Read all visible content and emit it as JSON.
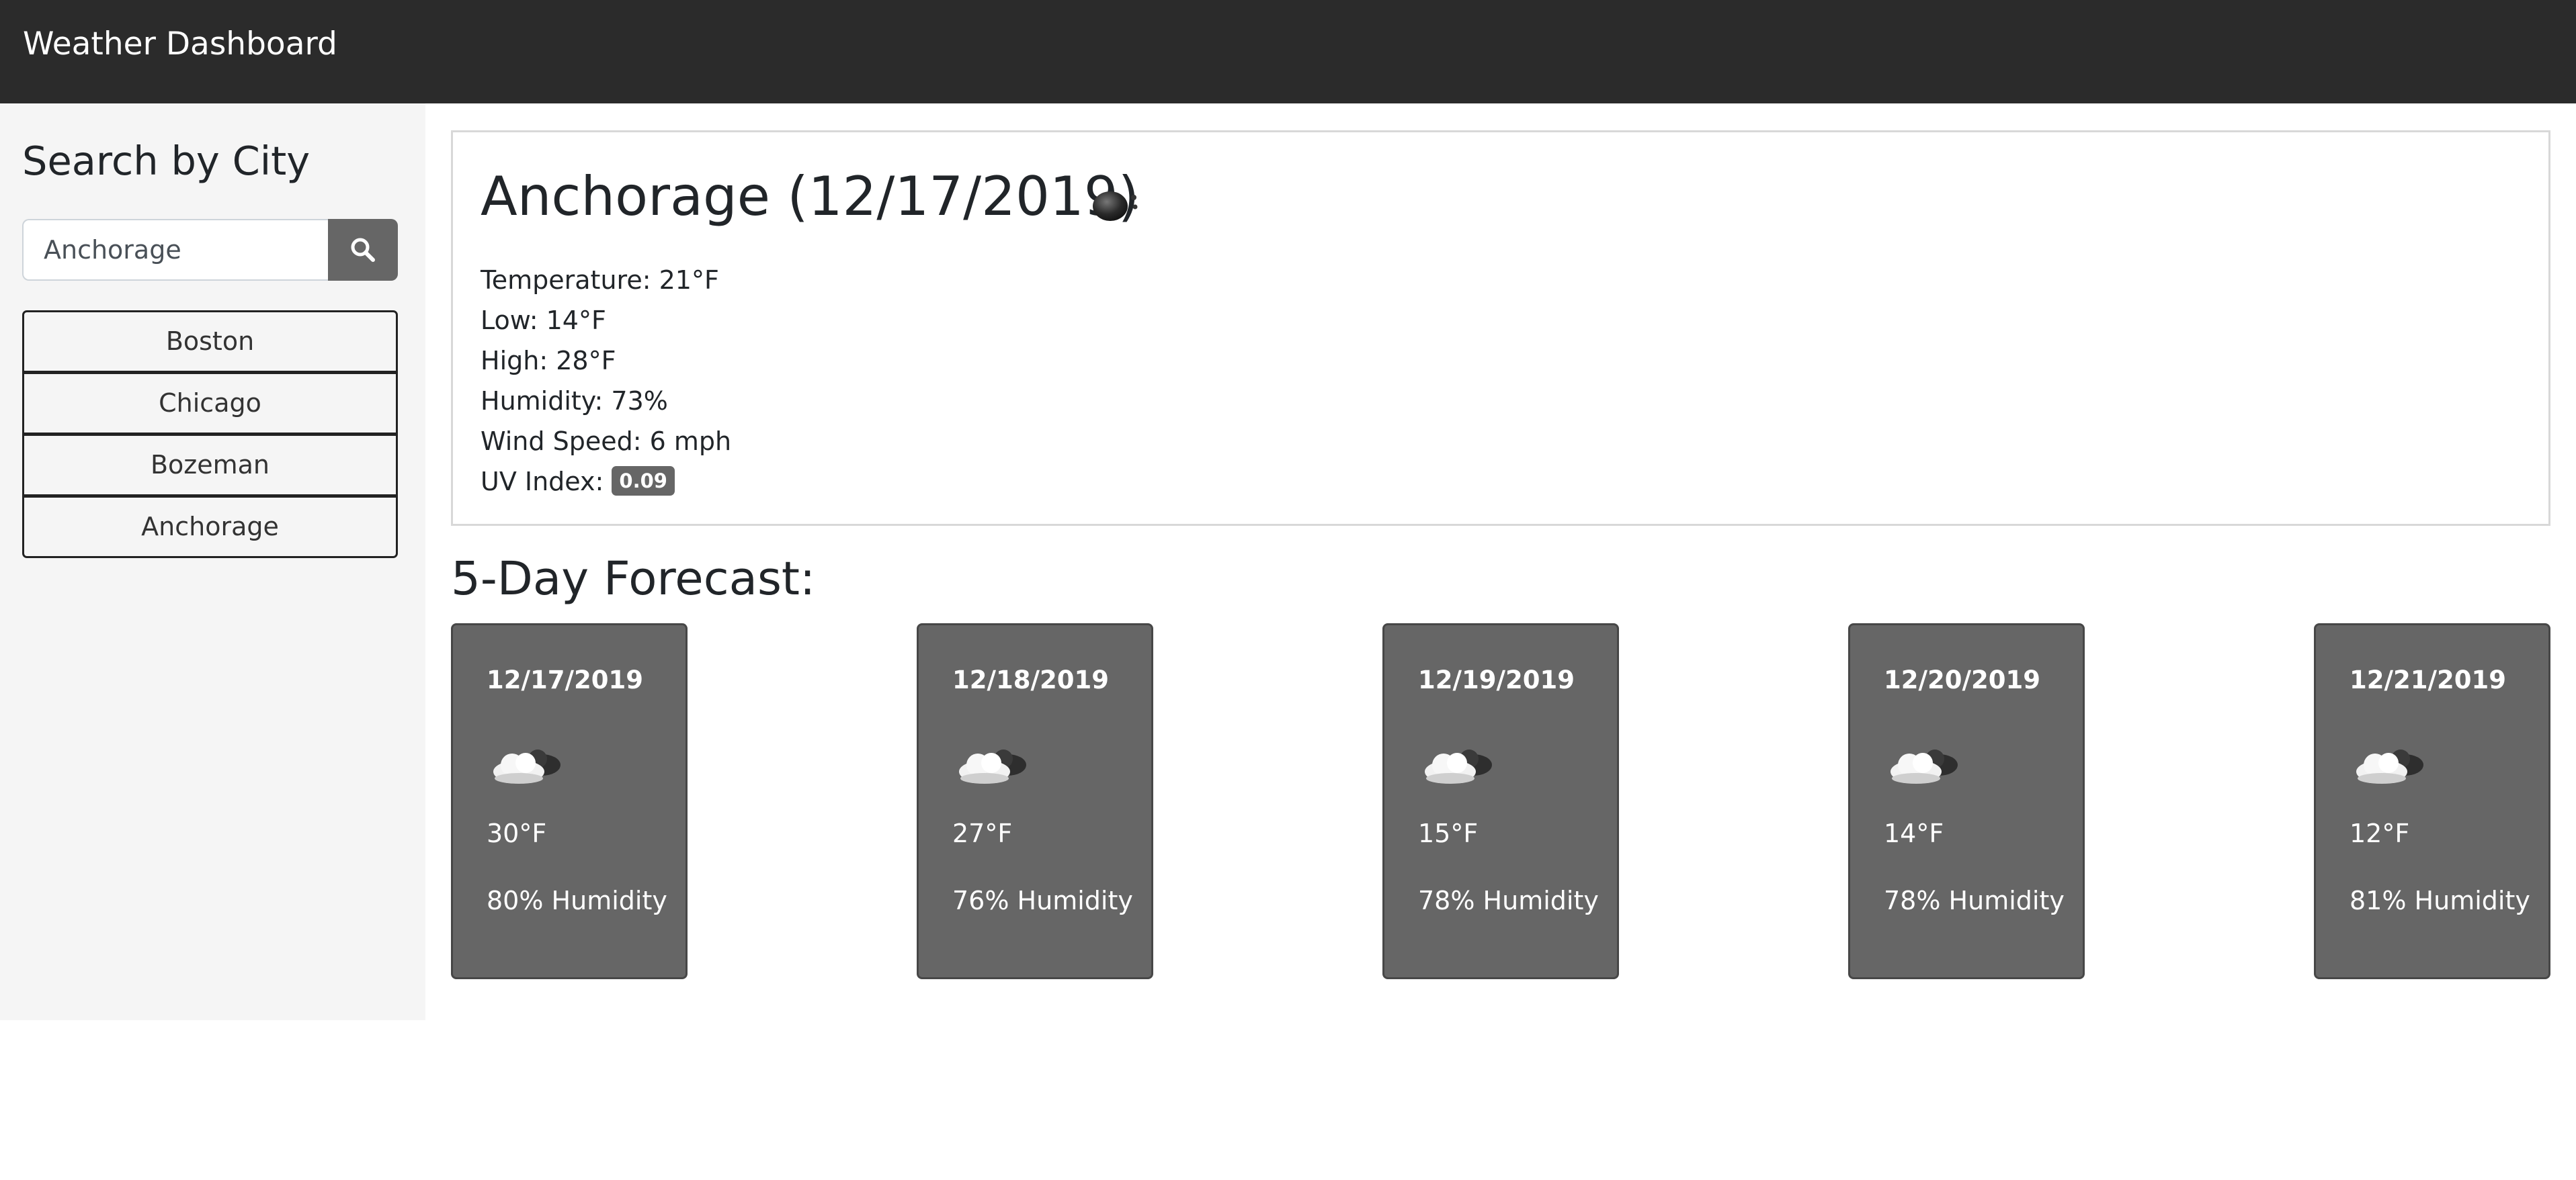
{
  "navbar": {
    "brand": "Weather Dashboard"
  },
  "sidebar": {
    "title": "Search by City",
    "search": {
      "value": "Anchorage",
      "button_icon": "search-icon"
    },
    "history": [
      {
        "label": "Boston"
      },
      {
        "label": "Chicago"
      },
      {
        "label": "Bozeman"
      },
      {
        "label": "Anchorage"
      }
    ]
  },
  "current": {
    "title": "Anchorage (12/17/2019)",
    "icon": "dark-moon-icon",
    "temperature": "Temperature: 21°F",
    "low": "Low: 14°F",
    "high": "High: 28°F",
    "humidity": "Humidity: 73%",
    "wind": "Wind Speed: 6 mph",
    "uv_label": "UV Index:",
    "uv_value": "0.09"
  },
  "forecast": {
    "heading": "5-Day Forecast:",
    "days": [
      {
        "date": "12/17/2019",
        "icon": "cloudy-icon",
        "temp": "30°F",
        "humidity": "80% Humidity"
      },
      {
        "date": "12/18/2019",
        "icon": "cloudy-icon",
        "temp": "27°F",
        "humidity": "76% Humidity"
      },
      {
        "date": "12/19/2019",
        "icon": "cloudy-icon",
        "temp": "15°F",
        "humidity": "78% Humidity"
      },
      {
        "date": "12/20/2019",
        "icon": "cloudy-icon",
        "temp": "14°F",
        "humidity": "78% Humidity"
      },
      {
        "date": "12/21/2019",
        "icon": "cloudy-icon",
        "temp": "12°F",
        "humidity": "81% Humidity"
      }
    ]
  },
  "colors": {
    "navbar_bg": "#2b2b2b",
    "sidebar_bg": "#f5f5f5",
    "card_bg": "#666666",
    "badge_bg": "#666666"
  }
}
